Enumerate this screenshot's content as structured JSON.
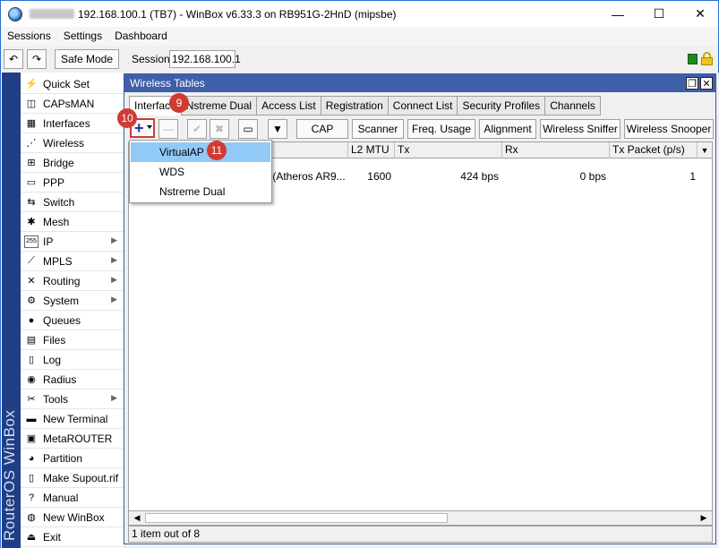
{
  "window": {
    "title": "192.168.100.1 (TB7) - WinBox v6.33.3 on RB951G-2HnD (mipsbe)",
    "minimize": "—",
    "maximize": "☐",
    "close": "✕"
  },
  "menu": [
    "Sessions",
    "Settings",
    "Dashboard"
  ],
  "toolbar": {
    "undo": "↶",
    "redo": "↷",
    "safe_mode": "Safe Mode",
    "session_label": "Session:",
    "session_value": "192.168.100.1"
  },
  "brand": "RouterOS WinBox",
  "sidebar": {
    "items": [
      {
        "label": "Quick Set",
        "icon": "quick-set-icon",
        "glyph": "⚡",
        "submenu": false
      },
      {
        "label": "CAPsMAN",
        "icon": "capsman-icon",
        "glyph": "◫",
        "submenu": false
      },
      {
        "label": "Interfaces",
        "icon": "interfaces-icon",
        "glyph": "▦",
        "submenu": false
      },
      {
        "label": "Wireless",
        "icon": "wireless-icon",
        "glyph": "⋰",
        "submenu": false
      },
      {
        "label": "Bridge",
        "icon": "bridge-icon",
        "glyph": "⊞",
        "submenu": false
      },
      {
        "label": "PPP",
        "icon": "ppp-icon",
        "glyph": "▭",
        "submenu": false
      },
      {
        "label": "Switch",
        "icon": "switch-icon",
        "glyph": "⇆",
        "submenu": false
      },
      {
        "label": "Mesh",
        "icon": "mesh-icon",
        "glyph": "✱",
        "submenu": false
      },
      {
        "label": "IP",
        "icon": "ip-icon",
        "glyph": "255",
        "submenu": true
      },
      {
        "label": "MPLS",
        "icon": "mpls-icon",
        "glyph": "⟋",
        "submenu": true
      },
      {
        "label": "Routing",
        "icon": "routing-icon",
        "glyph": "✕",
        "submenu": true
      },
      {
        "label": "System",
        "icon": "system-icon",
        "glyph": "⚙",
        "submenu": true
      },
      {
        "label": "Queues",
        "icon": "queues-icon",
        "glyph": "●",
        "submenu": false
      },
      {
        "label": "Files",
        "icon": "files-icon",
        "glyph": "▤",
        "submenu": false
      },
      {
        "label": "Log",
        "icon": "log-icon",
        "glyph": "▯",
        "submenu": false
      },
      {
        "label": "Radius",
        "icon": "radius-icon",
        "glyph": "◉",
        "submenu": false
      },
      {
        "label": "Tools",
        "icon": "tools-icon",
        "glyph": "✂",
        "submenu": true
      },
      {
        "label": "New Terminal",
        "icon": "terminal-icon",
        "glyph": "▬",
        "submenu": false
      },
      {
        "label": "MetaROUTER",
        "icon": "metarouter-icon",
        "glyph": "▣",
        "submenu": false
      },
      {
        "label": "Partition",
        "icon": "partition-icon",
        "glyph": "◕",
        "submenu": false
      },
      {
        "label": "Make Supout.rif",
        "icon": "supout-icon",
        "glyph": "▯",
        "submenu": false
      },
      {
        "label": "Manual",
        "icon": "manual-icon",
        "glyph": "?",
        "submenu": false
      },
      {
        "label": "New WinBox",
        "icon": "new-winbox-icon",
        "glyph": "◍",
        "submenu": false
      },
      {
        "label": "Exit",
        "icon": "exit-icon",
        "glyph": "⏏",
        "submenu": false
      }
    ]
  },
  "wireless_tables": {
    "title": "Wireless Tables",
    "restore": "❐",
    "close": "✕",
    "tabs": [
      "Interface",
      "Nstreme Dual",
      "Access List",
      "Registration",
      "Connect List",
      "Security Profiles",
      "Channels"
    ],
    "buttons": {
      "remove": "—",
      "enable": "✔",
      "disable": "✖",
      "comment": "▭",
      "filter": "▼",
      "cap": "CAP",
      "scanner": "Scanner",
      "freq_usage": "Freq. Usage",
      "alignment": "Alignment",
      "sniffer": "Wireless Sniffer",
      "snooper": "Wireless Snooper"
    },
    "columns": {
      "l2mtu": "L2 MTU",
      "tx": "Tx",
      "rx": "Rx",
      "tx_packet": "Tx Packet (p/s)"
    },
    "row": {
      "type": "ss (Atheros AR9...",
      "l2mtu": "1600",
      "tx": "424 bps",
      "rx": "0 bps",
      "tx_packet": "1"
    },
    "status": "1 item out of 8"
  },
  "dropdown": {
    "items": [
      "VirtualAP",
      "WDS",
      "Nstreme Dual"
    ]
  },
  "annotations": {
    "step9": "9",
    "step10": "10",
    "step11": "11"
  },
  "colors": {
    "accent": "#3f5fa8",
    "highlight": "#91c9f7",
    "badge": "#d03b34"
  }
}
